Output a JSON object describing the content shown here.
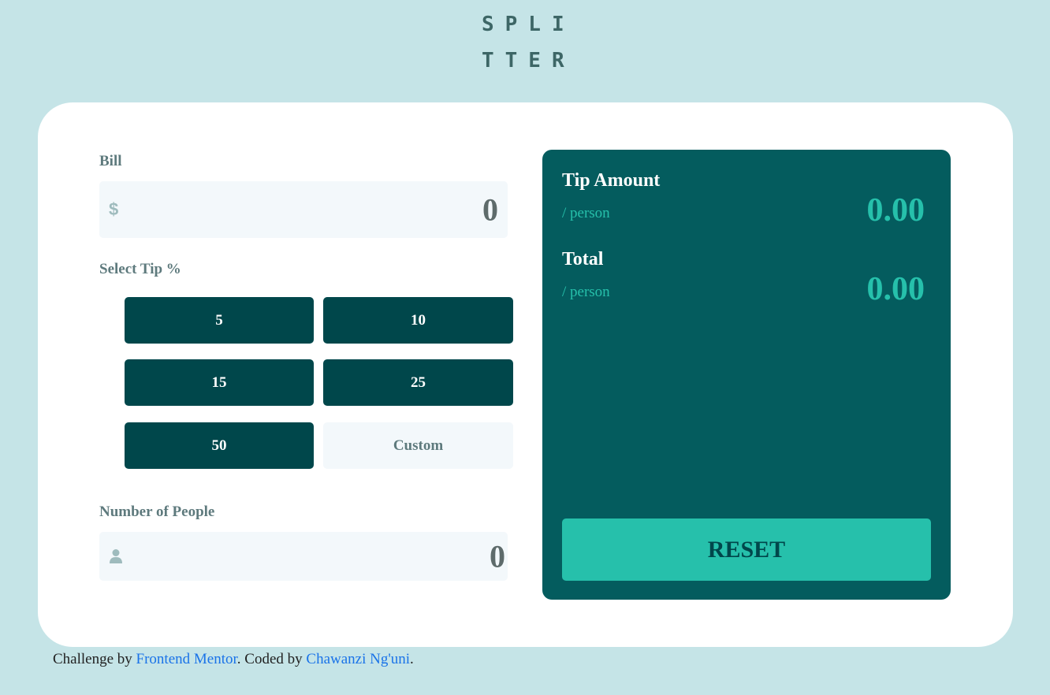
{
  "logo": {
    "line1": "SPLI",
    "line2": "TTER"
  },
  "bill": {
    "label": "Bill",
    "currency_icon": "$",
    "value": "0"
  },
  "tip": {
    "label": "Select Tip %",
    "options": [
      "5",
      "10",
      "15",
      "25",
      "50"
    ],
    "custom_label": "Custom"
  },
  "people": {
    "label": "Number of People",
    "icon": "person-icon",
    "value": "0"
  },
  "result": {
    "tip_title": "Tip Amount",
    "tip_sub": "/ person",
    "tip_value": "0.00",
    "total_title": "Total",
    "total_sub": "/ person",
    "total_value": "0.00",
    "reset_label": "RESET"
  },
  "footer": {
    "prefix": "Challenge by ",
    "link1": "Frontend Mentor",
    "middle": ". Coded by ",
    "link2": "Chawanzi Ng'uni",
    "suffix": "."
  },
  "colors": {
    "background": "#c5e4e7",
    "dark_cyan": "#00474b",
    "result_panel": "#045c5e",
    "accent": "#26c0ab"
  }
}
